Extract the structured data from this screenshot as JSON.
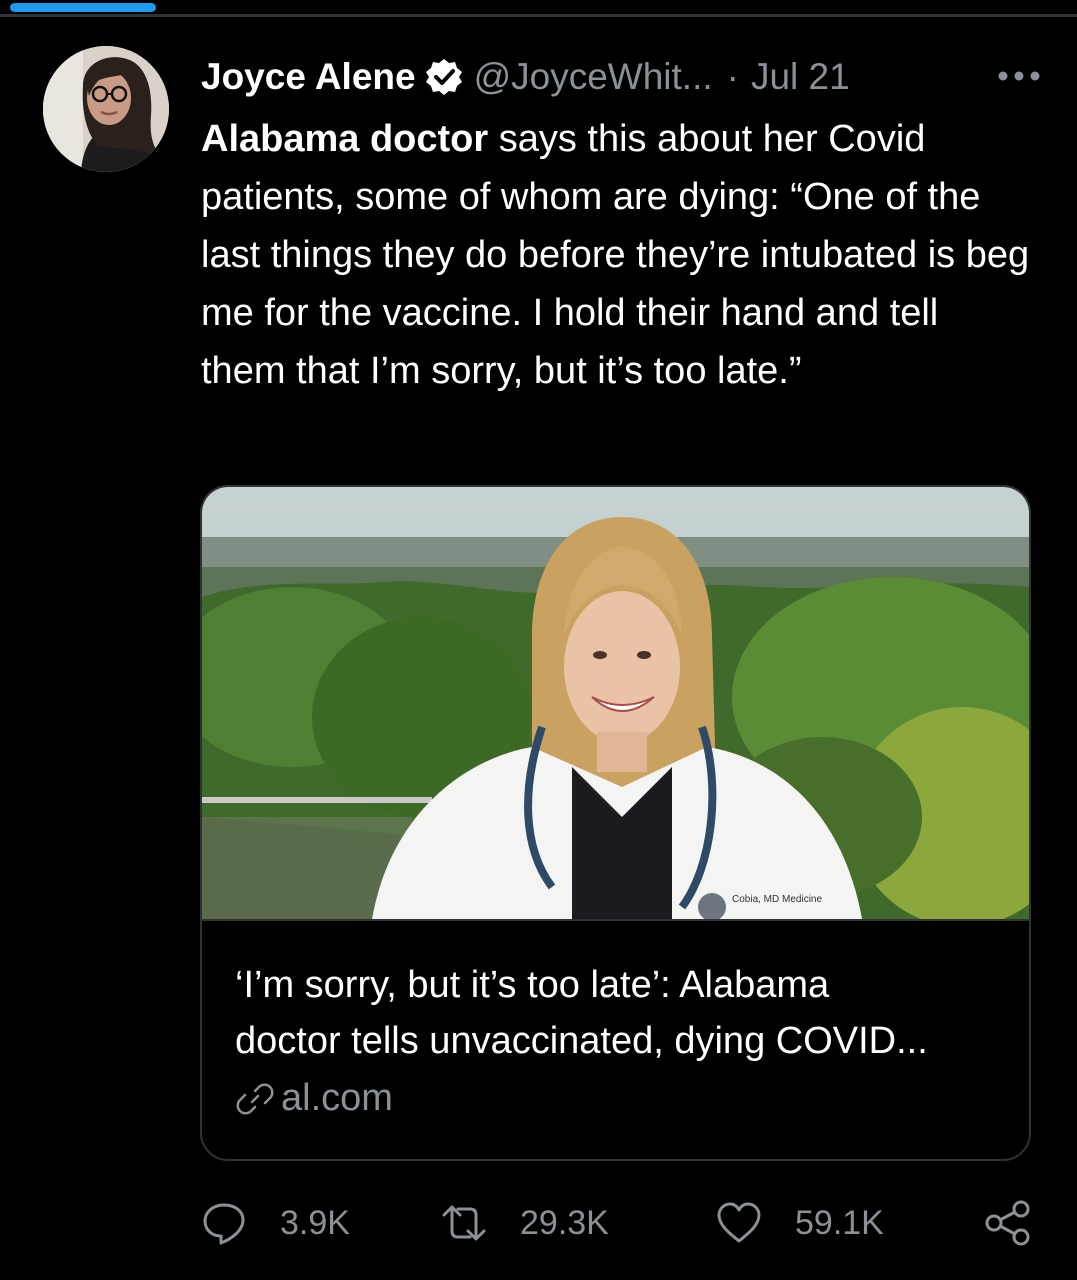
{
  "tweet": {
    "display_name": "Joyce Alene",
    "verified_icon": "verified-badge-icon",
    "handle": "@JoyceWhit...",
    "separator": "·",
    "date": "Jul 21",
    "more_icon": "more-options-icon",
    "text_bold": "Alabama doctor",
    "text_rest": " says this about her Covid patients, some of whom are dying: “One of the last things they do before they’re intubated is beg me for the vaccine. I hold their hand and tell them that I’m sorry, but it’s too late.”"
  },
  "card": {
    "image_caption_coat": "Cobia, MD Medicine",
    "title_line1": "‘I’m sorry, but it’s too late’: Alabama",
    "title_line2": "doctor tells unvaccinated, dying COVID...",
    "domain": "al.com",
    "link_icon": "link-icon"
  },
  "actions": {
    "replies": "3.9K",
    "retweets": "29.3K",
    "likes": "59.1K",
    "reply_icon": "reply-icon",
    "retweet_icon": "retweet-icon",
    "like_icon": "heart-icon",
    "share_icon": "share-icon"
  },
  "colors": {
    "background": "#000000",
    "text": "#ffffff",
    "secondary_text": "#8b9196",
    "border": "#2f3336",
    "accent": "#1d9bf0"
  }
}
